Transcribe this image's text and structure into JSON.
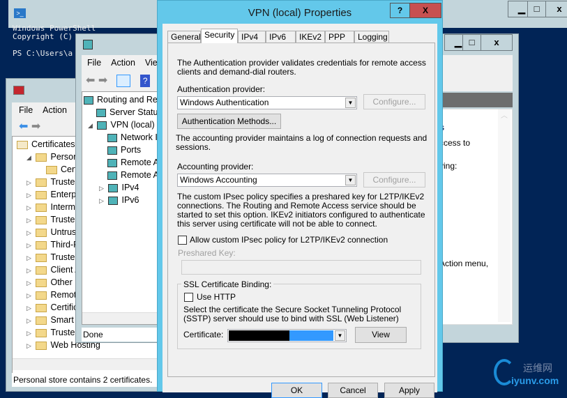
{
  "powershell": {
    "console_lines": [
      "Windows PowerShell",
      "Copyright (C)",
      "",
      "PS C:\\Users\\a"
    ],
    "icon": "powershell-icon"
  },
  "certs": {
    "menu": [
      "File",
      "Action"
    ],
    "tree_root": "Certificates -",
    "items": [
      {
        "label": "Personal",
        "expanded": true
      },
      {
        "label": "Certificates",
        "child": true
      },
      {
        "label": "Trusted Root"
      },
      {
        "label": "Enterprise"
      },
      {
        "label": "Intermediate"
      },
      {
        "label": "Trusted Publishers"
      },
      {
        "label": "Untrusted"
      },
      {
        "label": "Third-Party"
      },
      {
        "label": "Trusted People"
      },
      {
        "label": "Client Authentication"
      },
      {
        "label": "Other People"
      },
      {
        "label": "Remote Desktop"
      },
      {
        "label": "Certificate Enrollment"
      },
      {
        "label": "Smart Card"
      },
      {
        "label": "Trusted Devices"
      },
      {
        "label": "Web Hosting"
      }
    ],
    "status": "Personal store contains 2 certificates."
  },
  "rras": {
    "menu": [
      "File",
      "Action",
      "View"
    ],
    "root": "Routing and Remote Access",
    "items": [
      {
        "label": "Server Status",
        "level": 1
      },
      {
        "label": "VPN (local)",
        "level": 1,
        "expanded": true
      },
      {
        "label": "Network Interfaces",
        "level": 2
      },
      {
        "label": "Ports",
        "level": 2
      },
      {
        "label": "Remote Access Clients",
        "level": 2
      },
      {
        "label": "Remote Access Logging",
        "level": 2
      },
      {
        "label": "IPv4",
        "level": 2,
        "collapsed": true
      },
      {
        "label": "IPv6",
        "level": 2,
        "collapsed": true
      }
    ],
    "status": "Done",
    "right_text": [
      "s",
      "ccess to",
      "ving:",
      "Action menu,"
    ]
  },
  "dialog": {
    "title": "VPN (local) Properties",
    "help": "?",
    "close": "X",
    "tabs": [
      "General",
      "Security",
      "IPv4",
      "IPv6",
      "IKEv2",
      "PPP",
      "Logging"
    ],
    "active_tab": "Security",
    "auth_desc": "The Authentication provider validates credentials for remote access clients and demand-dial routers.",
    "auth_label": "Authentication provider:",
    "auth_value": "Windows Authentication",
    "configure": "Configure...",
    "auth_methods": "Authentication Methods...",
    "acct_desc": "The accounting provider maintains a log of connection requests and sessions.",
    "acct_label": "Accounting provider:",
    "acct_value": "Windows Accounting",
    "ipsec_desc": "The custom IPsec policy specifies a preshared key for L2TP/IKEv2 connections. The Routing and Remote Access service should be started to set this option. IKEv2 initiators configured to authenticate this server using certificate will not be able to connect.",
    "ipsec_check": "Allow custom IPsec policy for L2TP/IKEv2 connection",
    "ipsec_checked": false,
    "psk_label": "Preshared Key:",
    "psk_value": "",
    "ssl_group": "SSL Certificate Binding:",
    "use_http": "Use HTTP",
    "use_http_checked": false,
    "sstp_desc": "Select the certificate the Secure Socket Tunneling Protocol (SSTP) server should use to bind with SSL (Web Listener)",
    "cert_label": "Certificate:",
    "view": "View",
    "ok": "OK",
    "cancel": "Cancel",
    "apply": "Apply"
  },
  "watermark": {
    "cn": "运维网",
    "url": "iyunv.com"
  },
  "colors": {
    "console": "#012456",
    "dialog_frame": "#63c8ea",
    "close": "#c75050",
    "selection": "#3399ff"
  }
}
